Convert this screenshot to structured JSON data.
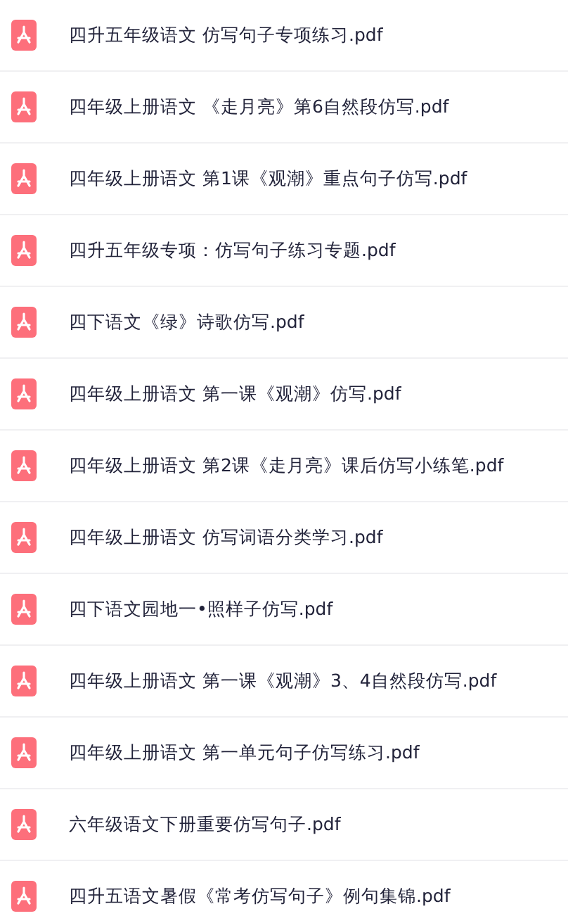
{
  "files": [
    {
      "name": "四升五年级语文 仿写句子专项练习.pdf"
    },
    {
      "name": "四年级上册语文 《走月亮》第6自然段仿写.pdf"
    },
    {
      "name": "四年级上册语文 第1课《观潮》重点句子仿写.pdf"
    },
    {
      "name": "四升五年级专项：仿写句子练习专题.pdf"
    },
    {
      "name": "四下语文《绿》诗歌仿写.pdf"
    },
    {
      "name": "四年级上册语文 第一课《观潮》仿写.pdf"
    },
    {
      "name": "四年级上册语文 第2课《走月亮》课后仿写小练笔.pdf"
    },
    {
      "name": "四年级上册语文 仿写词语分类学习.pdf"
    },
    {
      "name": "四下语文园地一•照样子仿写.pdf"
    },
    {
      "name": "四年级上册语文 第一课《观潮》3、4自然段仿写.pdf"
    },
    {
      "name": "四年级上册语文 第一单元句子仿写练习.pdf"
    },
    {
      "name": "六年级语文下册重要仿写句子.pdf"
    },
    {
      "name": "四升五语文暑假《常考仿写句子》例句集锦.pdf"
    }
  ]
}
